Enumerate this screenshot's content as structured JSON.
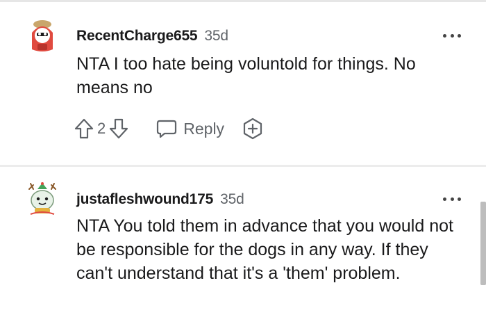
{
  "comments": [
    {
      "author": "RecentCharge655",
      "age": "35d",
      "text": "NTA I too hate being voluntold for things. No means no",
      "votes": "2",
      "reply_label": "Reply"
    },
    {
      "author": "justafleshwound175",
      "age": "35d",
      "text": "NTA You told them in advance that you would not be responsible for the dogs in any way. If they can't understand that it's a 'them' problem."
    }
  ],
  "colors": {
    "text": "#1a1a1b",
    "meta": "#5f6368",
    "divider": "#ececec",
    "avatar1_hood": "#e04a3f",
    "avatar2_hat": "#46a35a"
  },
  "icons": [
    "upvote-icon",
    "downvote-icon",
    "reply-icon",
    "award-icon",
    "more-options-icon"
  ]
}
